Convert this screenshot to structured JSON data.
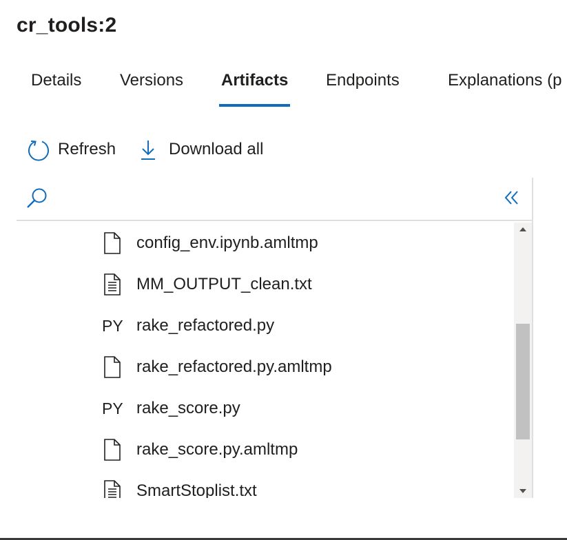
{
  "title": "cr_tools:2",
  "tabs": [
    {
      "label": "Details",
      "active": false
    },
    {
      "label": "Versions",
      "active": false
    },
    {
      "label": "Artifacts",
      "active": true
    },
    {
      "label": "Endpoints",
      "active": false
    },
    {
      "label": "Explanations (p",
      "active": false
    }
  ],
  "toolbar": {
    "refresh_label": "Refresh",
    "download_label": "Download all"
  },
  "colors": {
    "accent": "#0f6cbd",
    "text": "#201f1e",
    "divider": "#e1dfdd",
    "scroll_thumb": "#c1c1c1"
  },
  "files": [
    {
      "icon": "blank-file-icon",
      "name": "config_env.ipynb.amltmp"
    },
    {
      "icon": "text-file-icon",
      "name": "MM_OUTPUT_clean.txt"
    },
    {
      "icon": "py-file-icon",
      "type_label": "PY",
      "name": "rake_refactored.py"
    },
    {
      "icon": "blank-file-icon",
      "name": "rake_refactored.py.amltmp"
    },
    {
      "icon": "py-file-icon",
      "type_label": "PY",
      "name": "rake_score.py"
    },
    {
      "icon": "blank-file-icon",
      "name": "rake_score.py.amltmp"
    },
    {
      "icon": "text-file-icon",
      "name": "SmartStoplist.txt"
    }
  ]
}
